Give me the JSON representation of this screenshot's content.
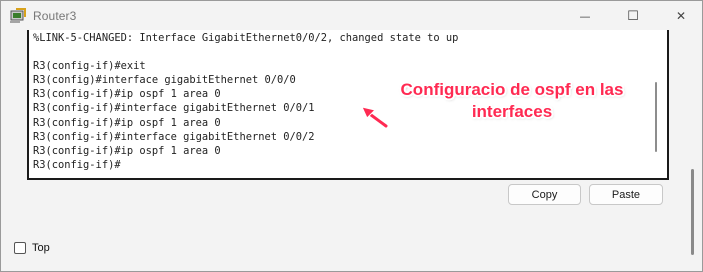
{
  "window": {
    "title": "Router3",
    "controls": {
      "minimize": "—",
      "maximize": "☐",
      "close": "✕"
    }
  },
  "console": {
    "lines": [
      "%LINK-5-CHANGED: Interface GigabitEthernet0/0/2, changed state to up",
      "",
      "R3(config-if)#exit",
      "R3(config)#interface gigabitEthernet 0/0/0",
      "R3(config-if)#ip ospf 1 area 0",
      "R3(config-if)#interface gigabitEthernet 0/0/1",
      "R3(config-if)#ip ospf 1 area 0",
      "R3(config-if)#interface gigabitEthernet 0/0/2",
      "R3(config-if)#ip ospf 1 area 0",
      "R3(config-if)#"
    ]
  },
  "annotation": {
    "line1": "Configuracio de ospf en las",
    "line2": "interfaces",
    "color": "#ff2a52"
  },
  "buttons": {
    "copy": "Copy",
    "paste": "Paste"
  },
  "options": {
    "top_label": "Top",
    "top_checked": false
  }
}
